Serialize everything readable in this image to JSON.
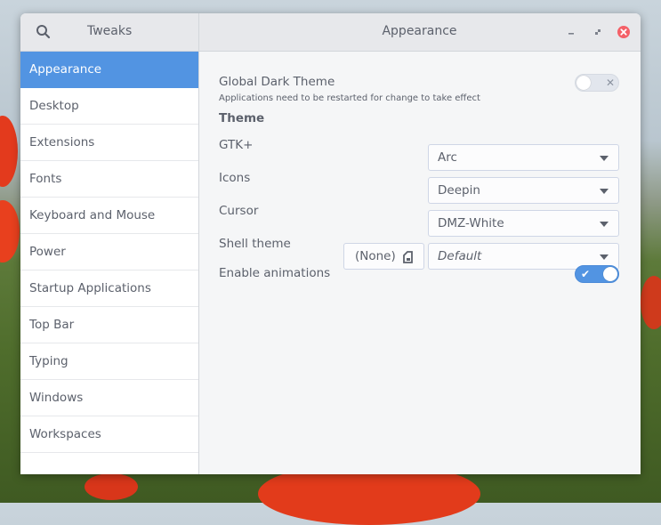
{
  "window": {
    "app_title": "Tweaks",
    "page_title": "Appearance"
  },
  "icons": {
    "search": "search-icon",
    "minimize": "minimize-icon",
    "maximize": "maximize-icon",
    "close": "close-icon",
    "file": "file-icon",
    "checkmark": "checkmark-icon",
    "x_mark": "x-mark-icon"
  },
  "colors": {
    "accent": "#5294e2",
    "close_button": "#f46067"
  },
  "sidebar": {
    "items": [
      {
        "label": "Appearance",
        "active": true
      },
      {
        "label": "Desktop",
        "active": false
      },
      {
        "label": "Extensions",
        "active": false
      },
      {
        "label": "Fonts",
        "active": false
      },
      {
        "label": "Keyboard and Mouse",
        "active": false
      },
      {
        "label": "Power",
        "active": false
      },
      {
        "label": "Startup Applications",
        "active": false
      },
      {
        "label": "Top Bar",
        "active": false
      },
      {
        "label": "Typing",
        "active": false
      },
      {
        "label": "Windows",
        "active": false
      },
      {
        "label": "Workspaces",
        "active": false
      }
    ]
  },
  "content": {
    "global_dark_theme": {
      "label": "Global Dark Theme",
      "note": "Applications need to be restarted for change to take effect",
      "enabled": false
    },
    "theme_heading": "Theme",
    "gtk": {
      "label": "GTK+",
      "value": "Arc"
    },
    "icons": {
      "label": "Icons",
      "value": "Deepin"
    },
    "cursor": {
      "label": "Cursor",
      "value": "DMZ-White"
    },
    "shell_theme": {
      "label": "Shell theme",
      "file_button": "(None)",
      "value": "Default"
    },
    "animations": {
      "label": "Enable animations",
      "enabled": true
    }
  }
}
